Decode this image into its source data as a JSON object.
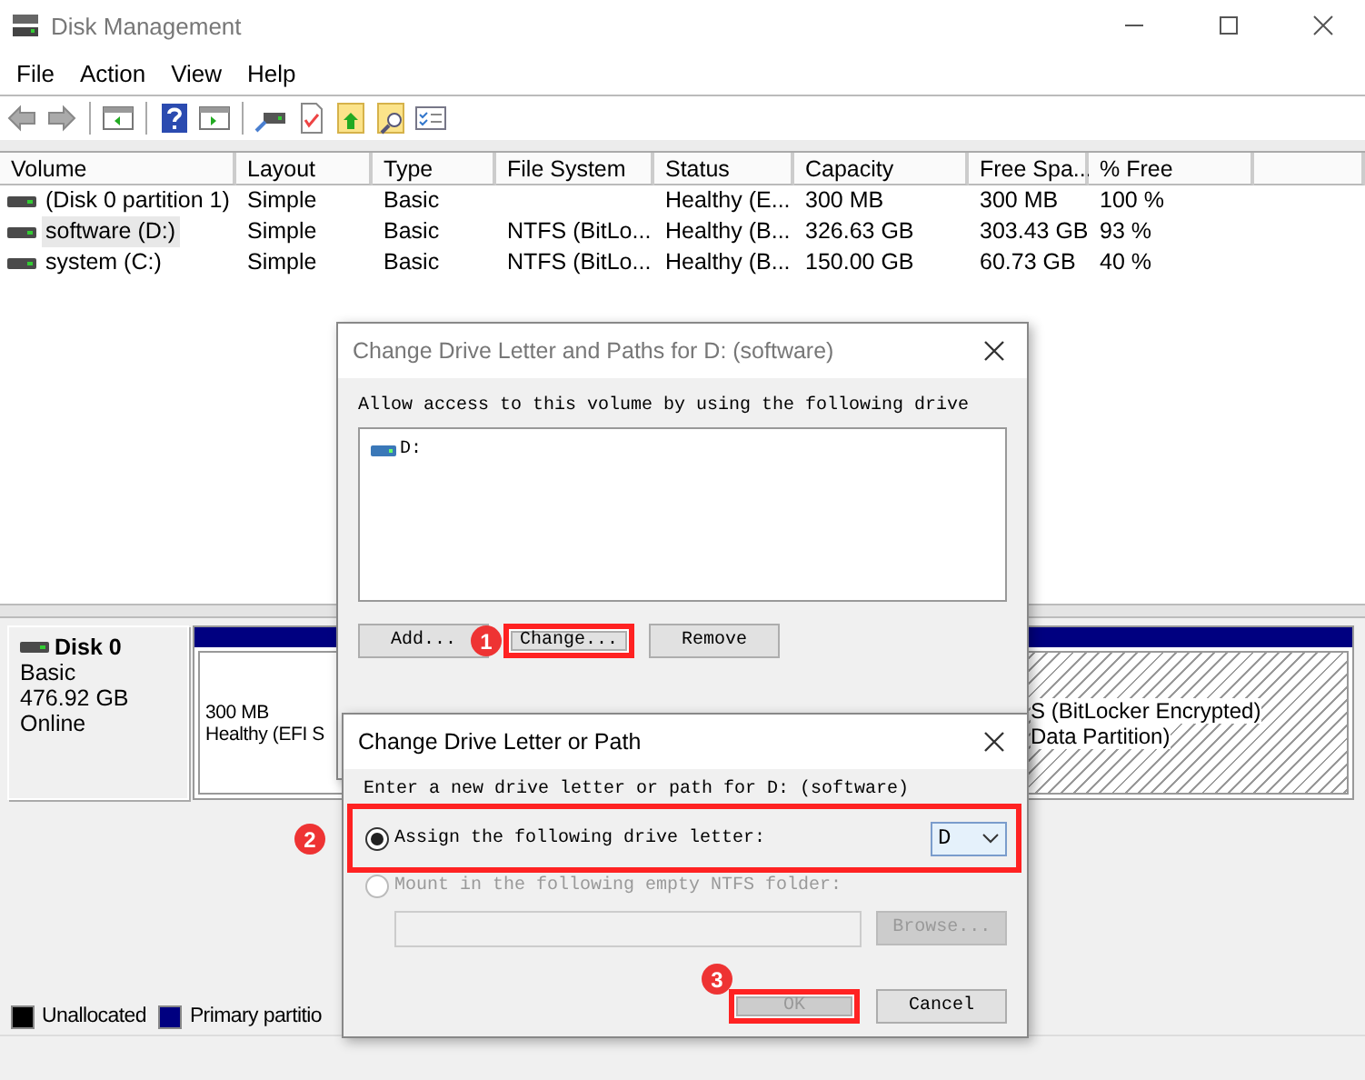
{
  "window": {
    "title": "Disk Management"
  },
  "menu": [
    "File",
    "Action",
    "View",
    "Help"
  ],
  "volumes": {
    "columns": [
      "Volume",
      "Layout",
      "Type",
      "File System",
      "Status",
      "Capacity",
      "Free Spa...",
      "% Free"
    ],
    "rows": [
      {
        "selected": false,
        "cells": [
          "(Disk 0 partition 1)",
          "Simple",
          "Basic",
          "",
          "Healthy (E...",
          "300 MB",
          "300 MB",
          "100 %"
        ]
      },
      {
        "selected": true,
        "cells": [
          "software (D:)",
          "Simple",
          "Basic",
          "NTFS (BitLo...",
          "Healthy (B...",
          "326.63 GB",
          "303.43 GB",
          "93 %"
        ]
      },
      {
        "selected": false,
        "cells": [
          "system (C:)",
          "Simple",
          "Basic",
          "NTFS (BitLo...",
          "Healthy (B...",
          "150.00 GB",
          "60.73 GB",
          "40 %"
        ]
      }
    ]
  },
  "disks": [
    {
      "name": "Disk 0",
      "type": "Basic",
      "size": "476.92 GB",
      "state": "Online",
      "partitions": [
        {
          "kind": "plain",
          "lines": [
            "300 MB",
            "Healthy (EFI S"
          ]
        },
        {
          "kind": "hatched",
          "lines": [
            "S (BitLocker Encrypted)",
            "Data Partition)"
          ]
        }
      ]
    }
  ],
  "legend": [
    {
      "label": "Unallocated",
      "color": "#000000"
    },
    {
      "label": "Primary partitio",
      "color": "#000080"
    }
  ],
  "dialog_paths": {
    "title": "Change Drive Letter and Paths for D: (software)",
    "prompt": "Allow access to this volume by using the following drive",
    "entries": [
      {
        "label": "D:"
      }
    ],
    "buttons": [
      {
        "label": "Add...",
        "highlighted": false
      },
      {
        "label": "Change...",
        "highlighted": true,
        "step": "1"
      },
      {
        "label": "Remove",
        "highlighted": false
      }
    ]
  },
  "dialog_letter": {
    "title": "Change Drive Letter or Path",
    "prompt": "Enter a new drive letter or path for D: (software)",
    "options": [
      {
        "label": "Assign the following drive letter:",
        "selected": true,
        "disabled": false,
        "highlighted": true,
        "step": "2"
      },
      {
        "label": "Mount in the following empty NTFS folder:",
        "selected": false,
        "disabled": true,
        "highlighted": false
      }
    ],
    "drive_letter": "D",
    "folder_field": {
      "disabled": true
    },
    "browse": {
      "label": "Browse...",
      "disabled": true
    },
    "buttons": [
      {
        "label": "OK",
        "disabled": true,
        "highlighted": true,
        "step": "3"
      },
      {
        "label": "Cancel",
        "disabled": false,
        "highlighted": false
      }
    ]
  }
}
